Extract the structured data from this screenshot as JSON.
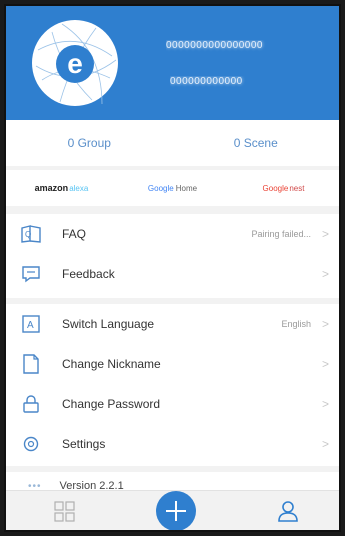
{
  "header": {
    "user_name": "0000000000000000",
    "user_id": "000000000000",
    "colors": {
      "primary": "#2f7fcf",
      "logo_fg": "#2f7fcf"
    }
  },
  "stats": {
    "group_label": "0 Group",
    "scene_label": "0 Scene"
  },
  "partners": {
    "amazon": "amazon",
    "amazon_sub": "alexa",
    "google_home": "Home",
    "google_nest": "nest",
    "google_word": "Google"
  },
  "menu": {
    "faq": {
      "label": "FAQ",
      "value": "Pairing failed...",
      "icon": "faq-icon"
    },
    "feedback": {
      "label": "Feedback",
      "icon": "feedback-icon"
    },
    "language": {
      "label": "Switch Language",
      "value": "English",
      "icon": "language-icon"
    },
    "nickname": {
      "label": "Change Nickname",
      "icon": "nickname-icon"
    },
    "password": {
      "label": "Change Password",
      "icon": "lock-icon"
    },
    "settings": {
      "label": "Settings",
      "icon": "gear-icon"
    }
  },
  "version": {
    "text": "Version  2.2.1"
  },
  "chevron": ">"
}
